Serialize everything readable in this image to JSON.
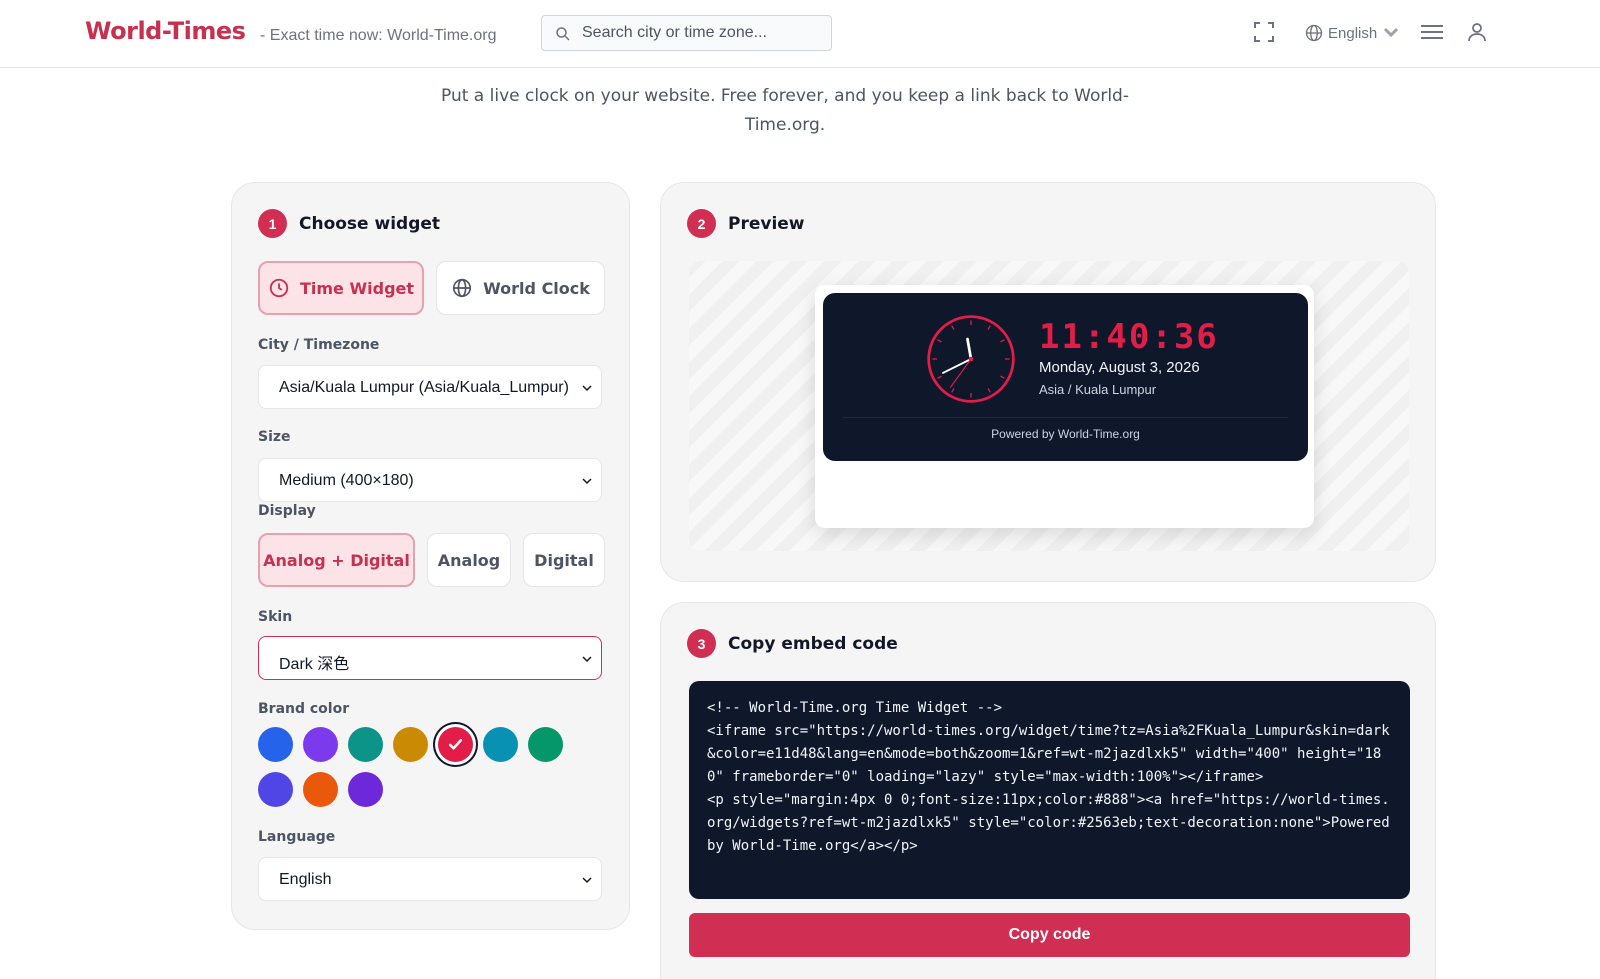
{
  "header": {
    "logo": "World-Times",
    "tagline": "- Exact time now: World-Time.org",
    "search_placeholder": "Search city or time zone...",
    "language": "English",
    "icons": [
      "search-icon",
      "fullscreen-icon",
      "globe-icon",
      "chevron-down-icon",
      "menu-icon",
      "user-icon"
    ]
  },
  "intro": "Put a live clock on your website. Free forever, and you keep a link back to World-Time.org.",
  "choose": {
    "step": "1",
    "title": "Choose widget",
    "widget_types": [
      {
        "label": "Time Widget",
        "icon": "clock-icon",
        "active": true
      },
      {
        "label": "World Clock",
        "icon": "globe-icon",
        "active": false
      }
    ],
    "city_label": "City / Timezone",
    "city_value": "Asia/Kuala Lumpur (Asia/Kuala_Lumpur)",
    "size_label": "Size",
    "size_value": "Medium (400×180)",
    "display_label": "Display",
    "display_options": [
      {
        "label": "Analog + Digital",
        "active": true
      },
      {
        "label": "Analog",
        "active": false
      },
      {
        "label": "Digital",
        "active": false
      }
    ],
    "skin_label": "Skin",
    "skin_value": "Dark 深色",
    "brand_label": "Brand color",
    "brand_colors": [
      "#2563eb",
      "#7c3aed",
      "#0d9488",
      "#ca8a04",
      "#e11d48",
      "#0891b2",
      "#059669",
      "#4f46e5",
      "#ea580c",
      "#6d28d9"
    ],
    "brand_selected": "#e11d48",
    "language_label": "Language",
    "language_value": "English"
  },
  "preview": {
    "step": "2",
    "title": "Preview",
    "time": "11:40:36",
    "date": "Monday, August 3, 2026",
    "city": "Asia / Kuala Lumpur",
    "powered": "Powered by World-Time.org",
    "accent": "#e11d48"
  },
  "embed": {
    "step": "3",
    "title": "Copy embed code",
    "code": "<!-- World-Time.org Time Widget -->\n<iframe src=\"https://world-times.org/widget/time?tz=Asia%2FKuala_Lumpur&skin=dark&color=e11d48&lang=en&mode=both&zoom=1&ref=wt-m2jazdlxk5\" width=\"400\" height=\"180\" frameborder=\"0\" loading=\"lazy\" style=\"max-width:100%\"></iframe>\n<p style=\"margin:4px 0 0;font-size:11px;color:#888\"><a href=\"https://world-times.org/widgets?ref=wt-m2jazdlxk5\" style=\"color:#2563eb;text-decoration:none\">Powered by World-Time.org</a></p>",
    "copy_label": "Copy code"
  }
}
